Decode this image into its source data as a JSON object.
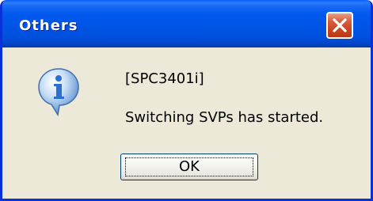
{
  "dialog": {
    "title": "Others",
    "close_icon": "close-x-icon",
    "icon": "information-icon",
    "message_code": "[SPC3401i]",
    "message_text": "Switching SVPs has started.",
    "ok_label": "OK"
  },
  "colors": {
    "titlebar": "#0054e3",
    "frame": "#0831d9",
    "body": "#ece9d8",
    "close_button": "#d75a3a",
    "info_icon": "#2b7bd9"
  }
}
